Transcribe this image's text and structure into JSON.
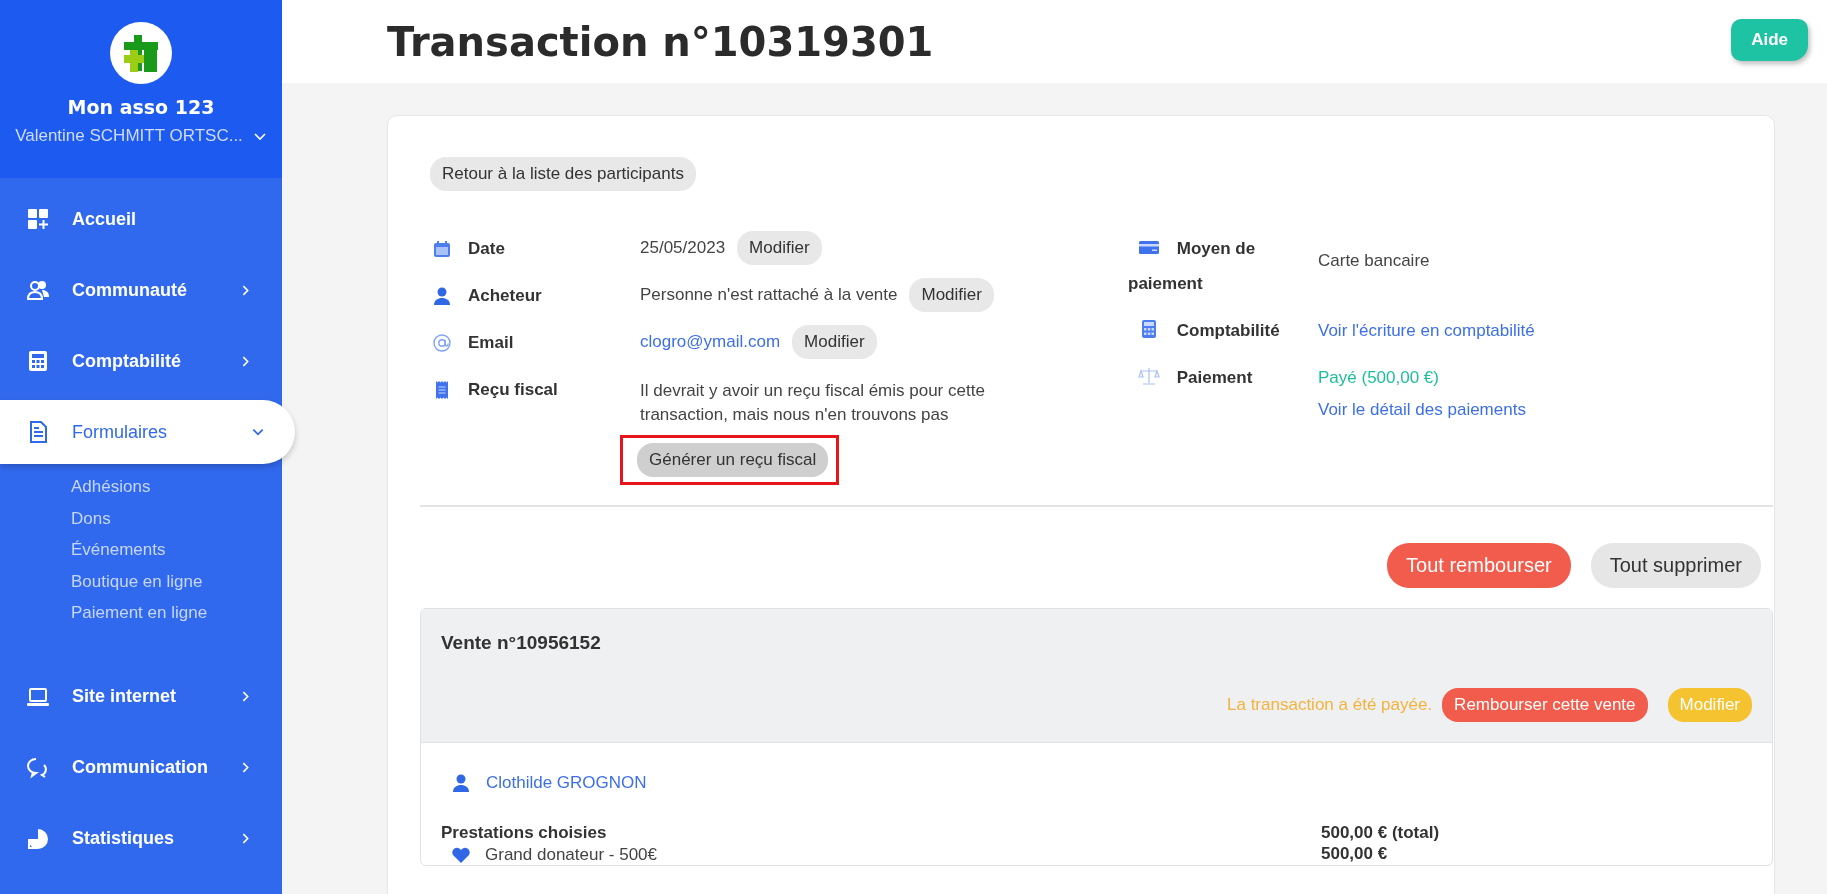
{
  "sidebar": {
    "org_name": "Mon asso 123",
    "user_name": "Valentine SCHMITT ORTSC...",
    "items": [
      {
        "label": "Accueil",
        "kind": "link",
        "selected": false
      },
      {
        "label": "Communauté",
        "kind": "group",
        "selected": false,
        "expanded": false
      },
      {
        "label": "Comptabilité",
        "kind": "group",
        "selected": false,
        "expanded": false
      },
      {
        "label": "Formulaires",
        "kind": "group",
        "selected": true,
        "expanded": true,
        "children": [
          {
            "label": "Adhésions"
          },
          {
            "label": "Dons"
          },
          {
            "label": "Événements"
          },
          {
            "label": "Boutique en ligne"
          },
          {
            "label": "Paiement en ligne"
          }
        ]
      },
      {
        "label": "Site internet",
        "kind": "group",
        "selected": false,
        "expanded": false
      },
      {
        "label": "Communication",
        "kind": "group",
        "selected": false,
        "expanded": false
      },
      {
        "label": "Statistiques",
        "kind": "group",
        "selected": false,
        "expanded": false
      }
    ]
  },
  "header": {
    "title": "Transaction n°10319301",
    "help_button": "Aide"
  },
  "back_button": "Retour à la liste des participants",
  "details_left": [
    {
      "label": "Date",
      "value": {
        "text": "25/05/2023",
        "kind": "text"
      },
      "action": "Modifier",
      "kind": "inline",
      "highlighted": false
    },
    {
      "label": "Acheteur",
      "value": {
        "text": "Personne n'est rattaché à la vente",
        "kind": "text"
      },
      "action": "Modifier",
      "kind": "inline",
      "highlighted": false
    },
    {
      "label": "Email",
      "value": {
        "text": "clogro@ymail.com",
        "kind": "link"
      },
      "action": "Modifier",
      "kind": "inline",
      "highlighted": false
    },
    {
      "label": "Reçu fiscal",
      "value": {
        "text": "Il devrait y avoir un reçu fiscal émis pour cette transaction, mais nous n'en trouvons pas",
        "kind": "text"
      },
      "action": "Générer un reçu fiscal",
      "kind": "stacked",
      "highlighted": true
    }
  ],
  "details_right": [
    {
      "label": "Moyen de paiement",
      "values": [
        {
          "text": "Carte bancaire",
          "kind": "text"
        }
      ]
    },
    {
      "label": "Comptabilité",
      "values": [
        {
          "text": "Voir l'écriture en comptabilité",
          "kind": "link"
        }
      ]
    },
    {
      "label": "Paiement",
      "values": [
        {
          "text": "Payé (500,00 €)",
          "kind": "status"
        },
        {
          "text": "Voir le détail des paiements",
          "kind": "link"
        }
      ]
    }
  ],
  "actions": {
    "refund_all": "Tout rembourser",
    "delete_all": "Tout supprimer"
  },
  "sale": {
    "title": "Vente n°10956152",
    "status": "La transaction a été payée.",
    "refund_button": "Rembourser cette vente",
    "edit_button": "Modifier",
    "person": "Clothilde GROGNON",
    "section_title": "Prestations choisies",
    "items": [
      {
        "label": "Grand donateur - 500€"
      }
    ],
    "amounts": [
      "500,00 € (total)",
      "500,00 €"
    ]
  }
}
